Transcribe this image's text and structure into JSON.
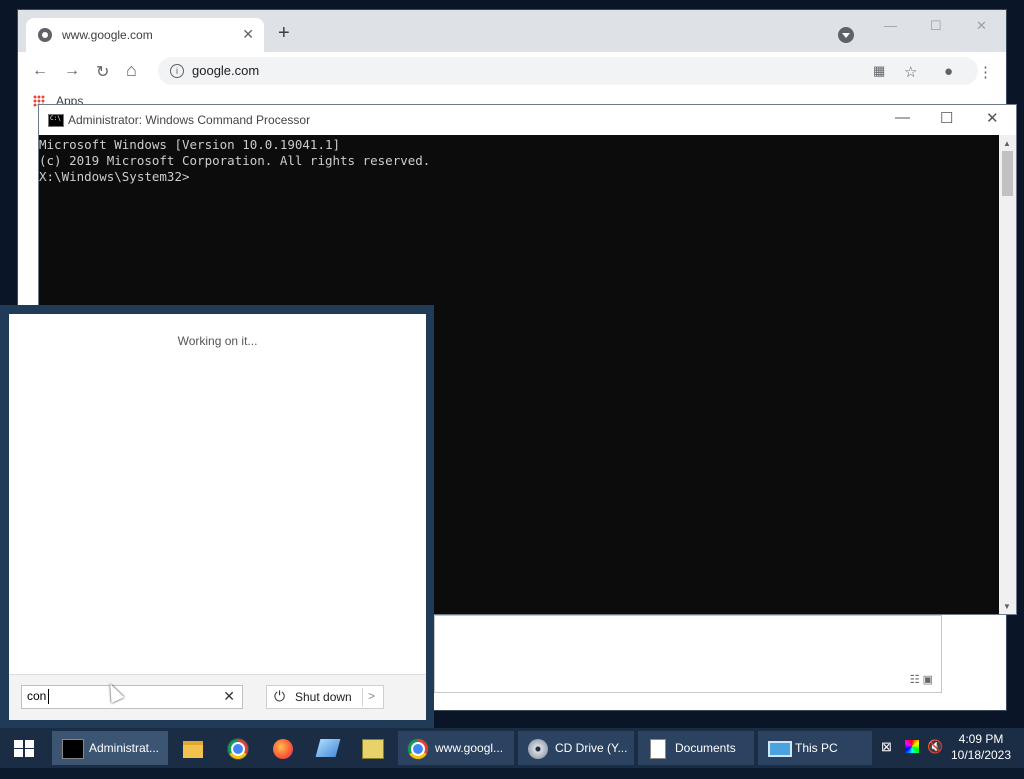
{
  "chrome": {
    "tab_title": "www.google.com",
    "tab_close": "✕",
    "new_tab": "+",
    "url": "google.com",
    "bookmarks_apps": "Apps",
    "min": "—",
    "max": "☐",
    "close": "✕",
    "back": "←",
    "forward": "→",
    "reload": "↻",
    "home": "⌂",
    "star": "☆",
    "menu": "⋮"
  },
  "cmd": {
    "title": "Administrator: Windows Command Processor",
    "min": "—",
    "max": "☐",
    "close": "✕",
    "lines": [
      "Microsoft Windows [Version 10.0.19041.1]",
      "(c) 2019 Microsoft Corporation. All rights reserved.",
      "",
      "X:\\Windows\\System32>"
    ]
  },
  "start": {
    "status": "Working on it...",
    "search_value": "con",
    "clear": "✕",
    "shutdown_label": "Shut down",
    "shutdown_arrow": ">",
    "power_glyph": "⏻"
  },
  "taskbar": {
    "items": [
      {
        "label": "Administrat...",
        "icon": "cmd-icon"
      },
      {
        "label": "",
        "icon": "file-explorer-icon"
      },
      {
        "label": "",
        "icon": "chrome-icon"
      },
      {
        "label": "",
        "icon": "firefox-icon"
      },
      {
        "label": "",
        "icon": "app-icon"
      },
      {
        "label": "",
        "icon": "spreadsheet-icon"
      },
      {
        "label": "www.googl...",
        "icon": "chrome-icon"
      },
      {
        "label": "CD Drive (Y...",
        "icon": "cd-drive-icon"
      },
      {
        "label": "Documents",
        "icon": "document-icon"
      },
      {
        "label": "This PC",
        "icon": "this-pc-icon"
      }
    ],
    "time": "4:09 PM",
    "date": "10/18/2023"
  }
}
